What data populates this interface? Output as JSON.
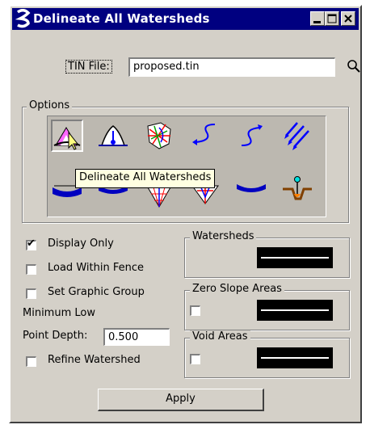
{
  "window": {
    "title": "Delineate All Watersheds"
  },
  "tin": {
    "label": "TIN File:",
    "value": "proposed.tin"
  },
  "options": {
    "label": "Options",
    "tooltip": "Delineate All Watersheds",
    "tools": [
      "delineate-all-watersheds",
      "single-watershed",
      "watershed-colors",
      "flow-path",
      "flow-path-arrow",
      "parallel-flow",
      "ponding-tool",
      "low-point",
      "colored-grid",
      "peak-tool",
      "channel-tool",
      "outlet-marker"
    ]
  },
  "checkboxes": {
    "display_only": {
      "label": "Display Only",
      "checked": true
    },
    "load_within_fence": {
      "label": "Load Within Fence",
      "checked": false
    },
    "set_graphic_group": {
      "label": "Set Graphic Group",
      "checked": false
    },
    "refine_watershed": {
      "label": "Refine Watershed",
      "checked": false
    }
  },
  "min_low": {
    "label1": "Minimum Low",
    "label2": "Point Depth:",
    "value": "0.500"
  },
  "watersheds": {
    "label": "Watersheds"
  },
  "zero_slope": {
    "label": "Zero Slope Areas",
    "checked": false
  },
  "void_areas": {
    "label": "Void Areas",
    "checked": false
  },
  "apply": {
    "label": "Apply"
  },
  "colors": {
    "titlebar": "#000080",
    "face": "#d4d0c8",
    "tooltip": "#ffffe1"
  }
}
